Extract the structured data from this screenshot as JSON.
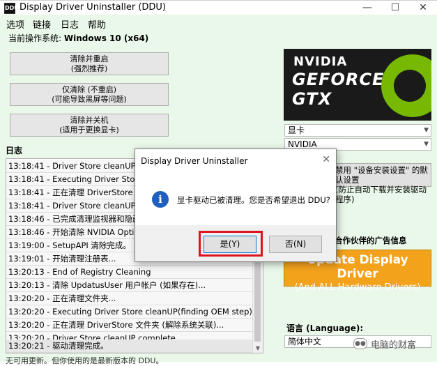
{
  "window": {
    "title": "Display Driver Uninstaller (DDU)",
    "icon_label": "DDU",
    "controls": [
      "—",
      "☐",
      "✕"
    ]
  },
  "menu": [
    "选项",
    "链接",
    "日志",
    "帮助"
  ],
  "os": {
    "label": "当前操作系统:",
    "value": "Windows 10 (x64)"
  },
  "actions": [
    {
      "line1": "清除并重启",
      "line2": "(强烈推荐)"
    },
    {
      "line1": "仅清除 (不重启)",
      "line2": "(可能导致黑屏等问题)"
    },
    {
      "line1": "清除并关机",
      "line2": "(适用于更换显卡)"
    }
  ],
  "log": {
    "title": "日志",
    "lines": [
      "13:18:41 - Driver Store cleanUP complete.",
      "13:18:41 - Executing Driver Store cleanUP(finding OEM step)...",
      "13:18:41 - 正在清理 DriverStore 文件夹 (解除系统关联)...",
      "13:18:41 - Driver Store cleanUP complete.",
      "13:18:46 - 已完成清理监视器和隐藏显示器...",
      "13:18:46 - 开始清除 NVIDIA Optimus...",
      "13:19:00 - SetupAPI 清除完成。",
      "13:19:01 - 开始清理注册表...",
      "13:20:13 - End of Registry Cleaning",
      "13:20:13 - 清除 UpdatusUser 用户帐户 (如果存在)...",
      "13:20:20 - 正在清理文件夹...",
      "13:20:20 - Executing Driver Store cleanUP(finding OEM step)...",
      "13:20:20 - 正在清理 DriverStore 文件夹 (解除系统关联)...",
      "13:20:20 - Driver Store cleanUP complete.",
      "13:20:21 - 驱动清理完成。"
    ],
    "footer": "无可用更新。但你使用的是最新版本的 DDU。"
  },
  "logo": {
    "line1": "NVIDIA",
    "line2": "GEFORCE",
    "line3": "GTX"
  },
  "device_type": {
    "value": "显卡",
    "options": [
      "显卡"
    ]
  },
  "vendor": {
    "value": "NVIDIA",
    "options": [
      "NVIDIA"
    ]
  },
  "right_button": {
    "line1": "禁用 \"设备安装设置\" 的默认设置",
    "line2": "(防止自动下载并安装驱动程序)"
  },
  "partner": {
    "label": "合作伙伴的广告信息",
    "banner_line1": "Update Display Driver",
    "banner_line2": "(And ALL Hardware Drivers)"
  },
  "language": {
    "label": "语言 (Language):",
    "value": "简体中文"
  },
  "watermark": "电脑的财富",
  "dialog": {
    "title": "Display Driver Uninstaller",
    "message": "显卡驱动已被清理。您是否希望退出 DDU?",
    "yes_label": "是(Y)",
    "no_label": "否(N)",
    "icon": "info-icon"
  },
  "colors": {
    "window_bg": "#eaf8ea",
    "nvidia_green": "#76b900",
    "ad_orange": "#f3a21c",
    "highlight_red": "#d9161d",
    "info_blue": "#1f5fbf"
  }
}
